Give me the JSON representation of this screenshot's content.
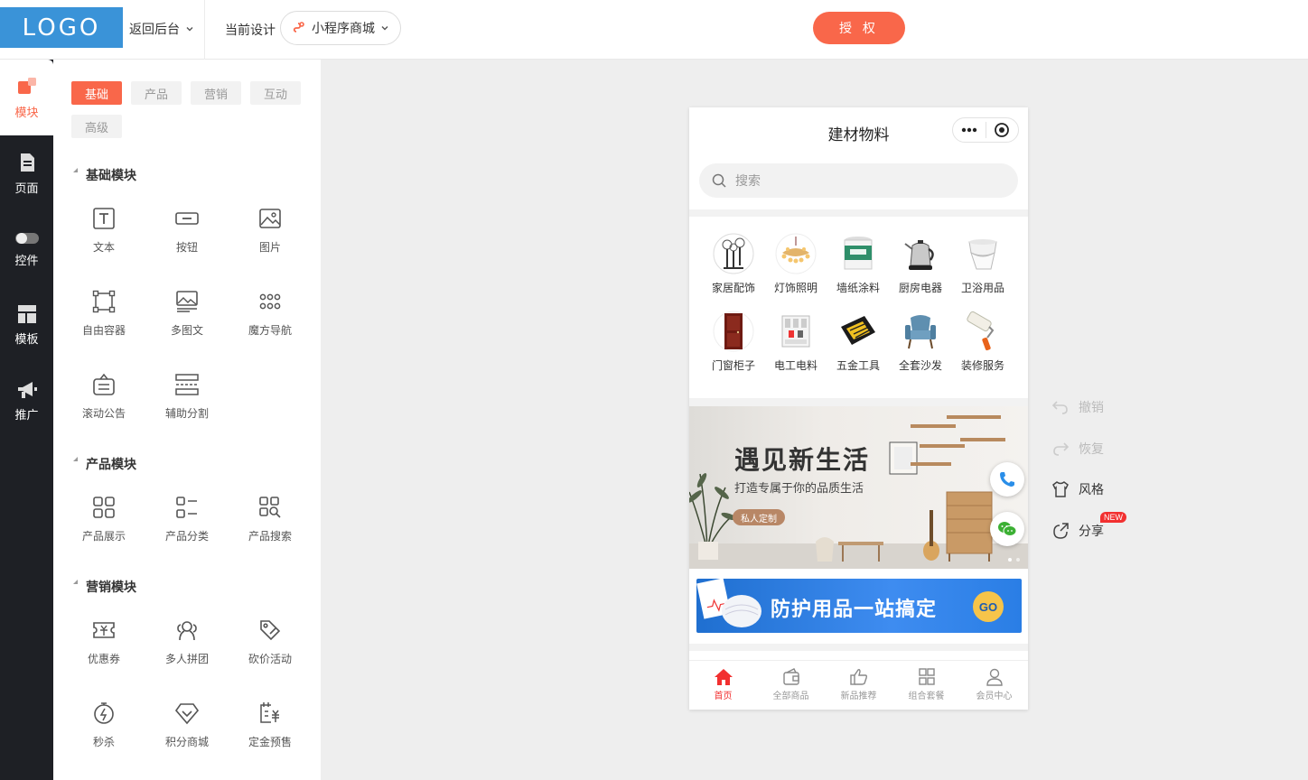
{
  "topbar": {
    "logo": "LOGO",
    "back_label": "返回后台",
    "current_label": "当前设计",
    "current_value": "小程序商城",
    "auth_label": "授 权"
  },
  "rail": [
    {
      "label": "模块",
      "icon": "module-icon",
      "active": true
    },
    {
      "label": "页面",
      "icon": "page-icon"
    },
    {
      "label": "控件",
      "icon": "toggle-icon"
    },
    {
      "label": "模板",
      "icon": "template-icon"
    },
    {
      "label": "推广",
      "icon": "megaphone-icon"
    }
  ],
  "tabs": [
    "基础",
    "产品",
    "营销",
    "互动",
    "高级"
  ],
  "sections": [
    {
      "title": "基础模块",
      "items": [
        {
          "label": "文本",
          "icon": "text-icon"
        },
        {
          "label": "按钮",
          "icon": "button-icon"
        },
        {
          "label": "图片",
          "icon": "image-icon"
        },
        {
          "label": "自由容器",
          "icon": "container-icon"
        },
        {
          "label": "多图文",
          "icon": "multi-image-icon"
        },
        {
          "label": "魔方导航",
          "icon": "grid-dots-icon"
        },
        {
          "label": "滚动公告",
          "icon": "notice-icon"
        },
        {
          "label": "辅助分割",
          "icon": "divider-icon"
        }
      ]
    },
    {
      "title": "产品模块",
      "items": [
        {
          "label": "产品展示",
          "icon": "product-grid-icon"
        },
        {
          "label": "产品分类",
          "icon": "category-icon"
        },
        {
          "label": "产品搜索",
          "icon": "product-search-icon"
        }
      ]
    },
    {
      "title": "营销模块",
      "items": [
        {
          "label": "优惠券",
          "icon": "coupon-icon"
        },
        {
          "label": "多人拼团",
          "icon": "group-icon"
        },
        {
          "label": "砍价活动",
          "icon": "bargain-icon"
        },
        {
          "label": "秒杀",
          "icon": "flash-sale-icon"
        },
        {
          "label": "积分商城",
          "icon": "points-icon"
        },
        {
          "label": "定金预售",
          "icon": "presale-icon"
        }
      ]
    }
  ],
  "phone": {
    "title": "建材物料",
    "search_placeholder": "搜索",
    "categories": [
      "家居配饰",
      "灯饰照明",
      "墙纸涂料",
      "厨房电器",
      "卫浴用品",
      "门窗柜子",
      "电工电料",
      "五金工具",
      "全套沙发",
      "装修服务"
    ],
    "banner": {
      "title": "遇见新生活",
      "subtitle": "打造专属于你的品质生活",
      "tag": "私人定制"
    },
    "promo": {
      "text": "防护用品一站搞定",
      "go": "GO"
    },
    "tabbar": [
      "首页",
      "全部商品",
      "新品推荐",
      "组合套餐",
      "会员中心"
    ]
  },
  "actions": [
    {
      "label": "撤销",
      "icon": "undo-icon",
      "disabled": true
    },
    {
      "label": "恢复",
      "icon": "redo-icon",
      "disabled": true
    },
    {
      "label": "风格",
      "icon": "shirt-icon",
      "disabled": false
    },
    {
      "label": "分享",
      "icon": "share-icon",
      "disabled": false,
      "badge": "NEW"
    }
  ],
  "colors": {
    "accent": "#f9674a",
    "logo_bg": "#3a93d8",
    "rail_bg": "#1e2025",
    "tab_active": "#f23030"
  }
}
